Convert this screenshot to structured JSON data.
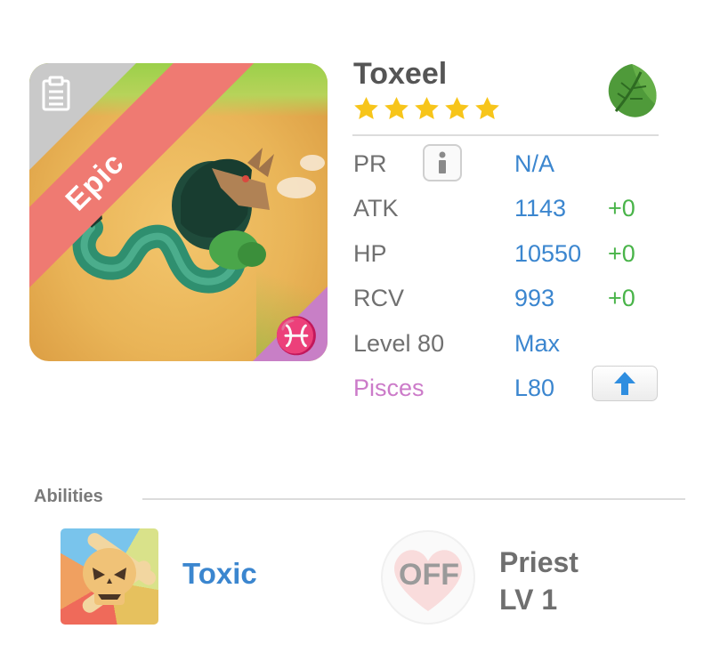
{
  "monster": {
    "name": "Toxeel",
    "stars": 5,
    "rarity": "Epic",
    "element": "leaf-icon",
    "zodiac_symbol": "♓"
  },
  "stats": {
    "pr": {
      "label": "PR",
      "value": "N/A"
    },
    "atk": {
      "label": "ATK",
      "value": "1143",
      "bonus": "+0"
    },
    "hp": {
      "label": "HP",
      "value": "10550",
      "bonus": "+0"
    },
    "rcv": {
      "label": "RCV",
      "value": "993",
      "bonus": "+0"
    },
    "level": {
      "label": "Level 80",
      "value": "Max"
    },
    "sign": {
      "label": "Pisces",
      "value": "L80"
    }
  },
  "abilities": {
    "section_label": "Abilities",
    "skill_name": "Toxic",
    "off_label": "OFF",
    "job_name": "Priest",
    "job_level": "LV 1"
  },
  "colors": {
    "value_blue": "#3b86cf",
    "bonus_green": "#49b449",
    "pisces_pink": "#cc7bc9",
    "epic_red": "#ef7a72",
    "star_gold": "#f7c51a"
  }
}
